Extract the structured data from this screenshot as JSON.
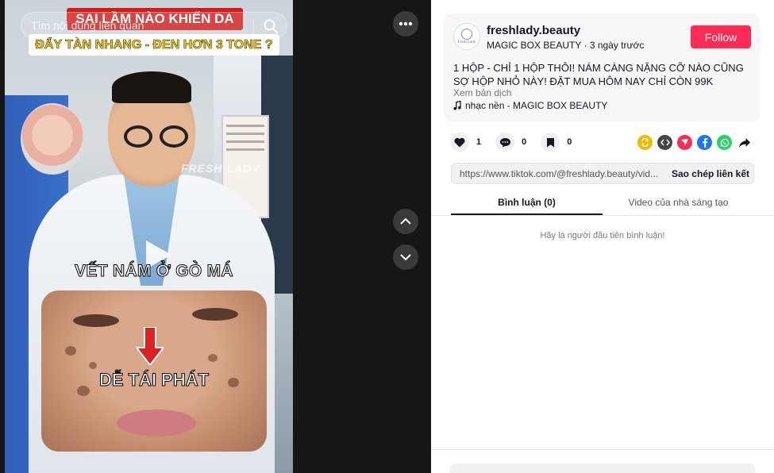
{
  "video": {
    "search_placeholder": "Tìm nội dung liên quan",
    "title_line1": "SAI LẦM NÀO KHIẾN DA",
    "title_line2": "ĐẨY TÀN NHANG - ĐEN HƠN 3 TONE ?",
    "watermark": "FRESH LADY",
    "caption_mid": "VẾT NÁM Ở GÒ MÁ",
    "caption_inset": "DỄ TÁI PHÁT",
    "icons": [
      "search-icon",
      "play-icon",
      "more-icon",
      "chevron-up-icon",
      "chevron-down-icon"
    ]
  },
  "author": {
    "username": "freshlady.beauty",
    "display_name": "MAGIC BOX BEAUTY",
    "separator": " · ",
    "posted": "3 ngày trước",
    "avatar_text": "Fresh Lady",
    "follow_label": "Follow"
  },
  "description": {
    "text": "1 HỘP - CHỈ 1 HỘP THÔI! NÁM CÀNG NẶNG CỠ NÀO CŨNG SỢ HỘP NHỎ NÀY! ĐẶT MUA HÔM NAY CHỈ CÒN 99K",
    "translate_label": "Xem bản dịch",
    "music": "nhạc nền - MAGIC BOX BEAUTY"
  },
  "stats": {
    "likes": "1",
    "comments": "0",
    "saves": "0"
  },
  "share_icons": [
    "repost-icon",
    "embed-icon",
    "send-icon",
    "facebook-icon",
    "whatsapp-icon",
    "share-arrow-icon"
  ],
  "colors": {
    "follow": "#fe2c55",
    "repost": "#f5b800",
    "embed": "#444444",
    "send": "#fe2c55",
    "facebook": "#1877f2",
    "whatsapp": "#25d366"
  },
  "link": {
    "url": "https://www.tiktok.com/@freshlady.beauty/vid...",
    "copy_label": "Sao chép liên kết"
  },
  "tabs": [
    {
      "label": "Bình luận (0)"
    },
    {
      "label": "Video của nhà sáng tạo"
    }
  ],
  "comments": {
    "empty_message": "Hãy là người đầu tiên bình luận!"
  }
}
